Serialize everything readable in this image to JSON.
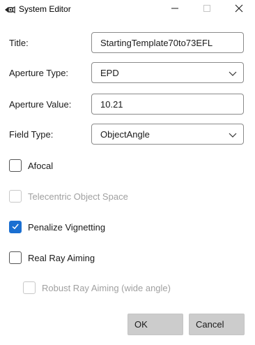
{
  "window": {
    "title": "System Editor",
    "icon": "camera-lens-icon",
    "controls": [
      "minimize-icon",
      "maximize-icon",
      "close-icon"
    ]
  },
  "fields": {
    "title": {
      "label": "Title:",
      "value": "StartingTemplate70to73EFL"
    },
    "aperture_type": {
      "label": "Aperture Type:",
      "value": "EPD"
    },
    "aperture_value": {
      "label": "Aperture Value:",
      "value": "10.21"
    },
    "field_type": {
      "label": "Field Type:",
      "value": "ObjectAngle"
    }
  },
  "checkboxes": {
    "afocal": {
      "label": "Afocal",
      "checked": false,
      "enabled": true
    },
    "telecentric": {
      "label": "Telecentric Object Space",
      "checked": false,
      "enabled": false
    },
    "penalize_vignetting": {
      "label": "Penalize Vignetting",
      "checked": true,
      "enabled": true
    },
    "real_ray_aiming": {
      "label": "Real Ray Aiming",
      "checked": false,
      "enabled": true
    },
    "robust_ray_aiming": {
      "label": "Robust Ray Aiming (wide angle)",
      "checked": false,
      "enabled": false
    }
  },
  "buttons": {
    "ok": "OK",
    "cancel": "Cancel"
  },
  "colors": {
    "accent": "#1a6fd1",
    "button_bg": "#cccccc",
    "disabled_text": "#a0a0a0"
  }
}
